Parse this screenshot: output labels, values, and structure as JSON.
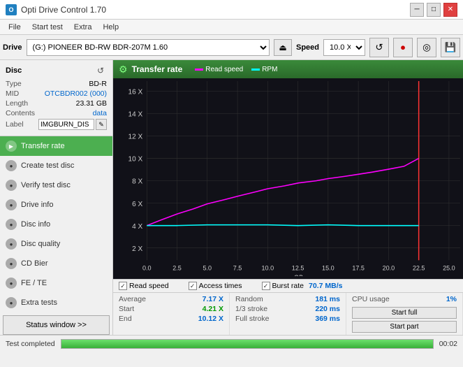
{
  "titleBar": {
    "title": "Opti Drive Control 1.70",
    "icon": "O",
    "controls": [
      "─",
      "□",
      "✕"
    ]
  },
  "menuBar": {
    "items": [
      "File",
      "Start test",
      "Extra",
      "Help"
    ]
  },
  "driveBar": {
    "label": "Drive",
    "driveValue": "(G:)  PIONEER BD-RW   BDR-207M 1.60",
    "ejectIcon": "⏏",
    "speedLabel": "Speed",
    "speedValue": "10.0 X",
    "icons": [
      "↺",
      "🔴",
      "🎯",
      "💾"
    ]
  },
  "disc": {
    "title": "Disc",
    "refreshIcon": "↺",
    "type": {
      "label": "Type",
      "value": "BD-R"
    },
    "mid": {
      "label": "MID",
      "value": "OTCBDR002 (000)"
    },
    "length": {
      "label": "Length",
      "value": "23.31 GB"
    },
    "contents": {
      "label": "Contents",
      "value": "data"
    },
    "label": {
      "label": "Label",
      "value": "IMGBURN_DIS"
    }
  },
  "nav": {
    "items": [
      {
        "id": "transfer-rate",
        "label": "Transfer rate",
        "active": true
      },
      {
        "id": "create-test-disc",
        "label": "Create test disc",
        "active": false
      },
      {
        "id": "verify-test-disc",
        "label": "Verify test disc",
        "active": false
      },
      {
        "id": "drive-info",
        "label": "Drive info",
        "active": false
      },
      {
        "id": "disc-info",
        "label": "Disc info",
        "active": false
      },
      {
        "id": "disc-quality",
        "label": "Disc quality",
        "active": false
      },
      {
        "id": "cd-bier",
        "label": "CD Bier",
        "active": false
      },
      {
        "id": "fe-te",
        "label": "FE / TE",
        "active": false
      },
      {
        "id": "extra-tests",
        "label": "Extra tests",
        "active": false
      }
    ],
    "statusButton": "Status window >>"
  },
  "chart": {
    "title": "Transfer rate",
    "icon": "⚙",
    "legend": [
      {
        "id": "read-speed",
        "label": "Read speed",
        "color": "magenta"
      },
      {
        "id": "rpm",
        "label": "RPM",
        "color": "cyan"
      }
    ],
    "yAxis": {
      "labels": [
        "16 X",
        "14 X",
        "12 X",
        "10 X",
        "8 X",
        "6 X",
        "4 X",
        "2 X"
      ],
      "min": 0,
      "max": 16
    },
    "xAxis": {
      "labels": [
        "0.0",
        "2.5",
        "5.0",
        "7.5",
        "10.0",
        "12.5",
        "15.0",
        "17.5",
        "20.0",
        "22.5",
        "25.0"
      ],
      "unit": "GB"
    },
    "verticalLine": {
      "x": 22.5,
      "color": "red"
    }
  },
  "statsBar": {
    "checkboxes": [
      {
        "id": "read-speed",
        "label": "Read speed",
        "checked": true
      },
      {
        "id": "access-times",
        "label": "Access times",
        "checked": true
      },
      {
        "id": "burst-rate",
        "label": "Burst rate",
        "checked": true
      }
    ],
    "burstValue": "70.7 MB/s"
  },
  "numbers": {
    "average": {
      "label": "Average",
      "value": "7.17 X"
    },
    "random": {
      "label": "Random",
      "value": "181 ms"
    },
    "cpuUsage": {
      "label": "CPU usage",
      "value": "1%"
    },
    "start": {
      "label": "Start",
      "value": "4.21 X"
    },
    "oneThirdStroke": {
      "label": "1/3 stroke",
      "value": "220 ms"
    },
    "startFull": "Start full",
    "end": {
      "label": "End",
      "value": "10.12 X"
    },
    "fullStroke": {
      "label": "Full stroke",
      "value": "369 ms"
    },
    "startPart": "Start part"
  },
  "bottom": {
    "status": "Test completed",
    "progress": 100,
    "time": "00:02"
  }
}
